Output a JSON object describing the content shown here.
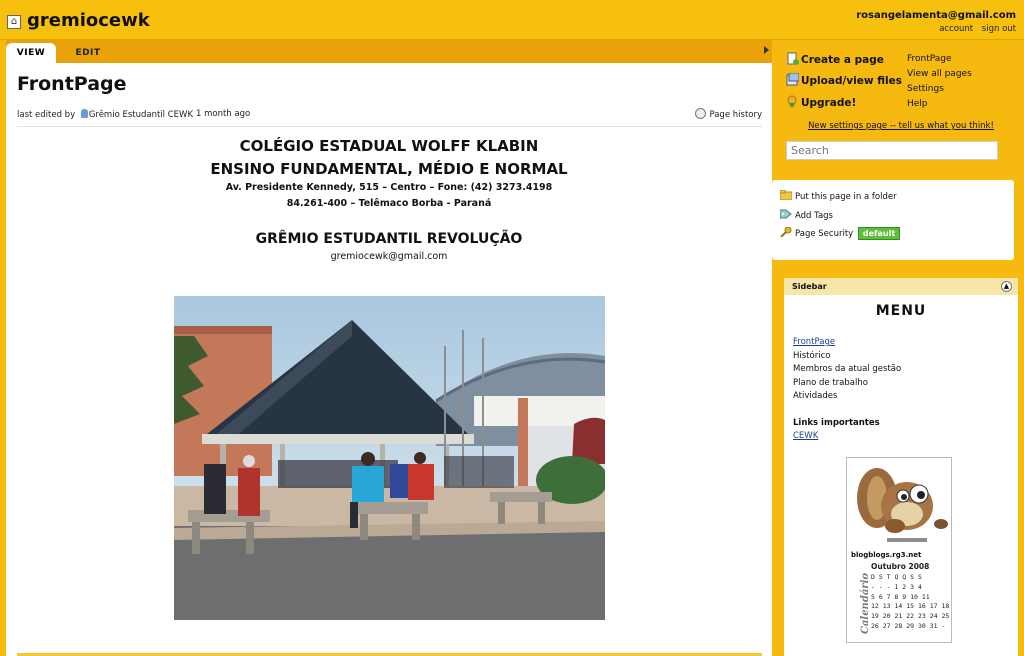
{
  "header": {
    "wiki_name": "gremiocewk",
    "user_email": "rosangelamenta@gmail.com",
    "account_link": "account",
    "signout_link": "sign out"
  },
  "tabs": {
    "view": "VIEW",
    "edit": "EDIT"
  },
  "page": {
    "title": "FrontPage",
    "last_edited_by_label": "last edited by",
    "last_edited_by_user": "Grêmio Estudantil CEWK",
    "edited_time": "1 month ago",
    "history_label": "Page history"
  },
  "content": {
    "school_name": "COLÉGIO ESTADUAL WOLFF KLABIN",
    "school_levels": "ENSINO FUNDAMENTAL, MÉDIO E NORMAL",
    "address_line1": "Av. Presidente Kennedy, 515 – Centro – Fone: (42) 3273.4198",
    "address_line2": "84.261-400 – Telêmaco Borba - Paraná",
    "gremio_name": "GRÊMIO ESTUDANTIL REVOLUÇÃO",
    "gremio_email": "gremiocewk@gmail.com"
  },
  "actions": {
    "create_page": "Create a page",
    "upload_files": "Upload/view files",
    "upgrade": "Upgrade!",
    "nav": [
      "FrontPage",
      "View all pages",
      "Settings",
      "Help"
    ],
    "settings_feedback": "New settings page -- tell us what you think!",
    "search_placeholder": "Search"
  },
  "page_tools": {
    "folder": "Put this page in a folder",
    "tags": "Add Tags",
    "security": "Page Security",
    "security_badge": "default"
  },
  "sidebar": {
    "heading": "Sidebar",
    "menu_title": "MENU",
    "menu_items": [
      "FrontPage",
      "Histórico",
      "Membros da atual gestão",
      "Plano de trabalho",
      "Atividades"
    ],
    "links_heading": "Links importantes",
    "links": [
      "CEWK"
    ],
    "widget": {
      "site": "blogblogs.rg3.net",
      "month": "Outubro 2008",
      "weekdays": "D S T Q Q S S",
      "rows": [
        "- - - 1 2 3 4",
        "5 6 7 8 9 10 11",
        "12 13 14 15 16 17 18",
        "19 20 21 22 23 24 25",
        "26 27 28 29 30 31 -"
      ],
      "vertical_label": "Calendário"
    }
  },
  "colors": {
    "brand_yellow": "#f5b90f",
    "tab_bar": "#eaa20a",
    "badge_green": "#5fbf3a"
  }
}
